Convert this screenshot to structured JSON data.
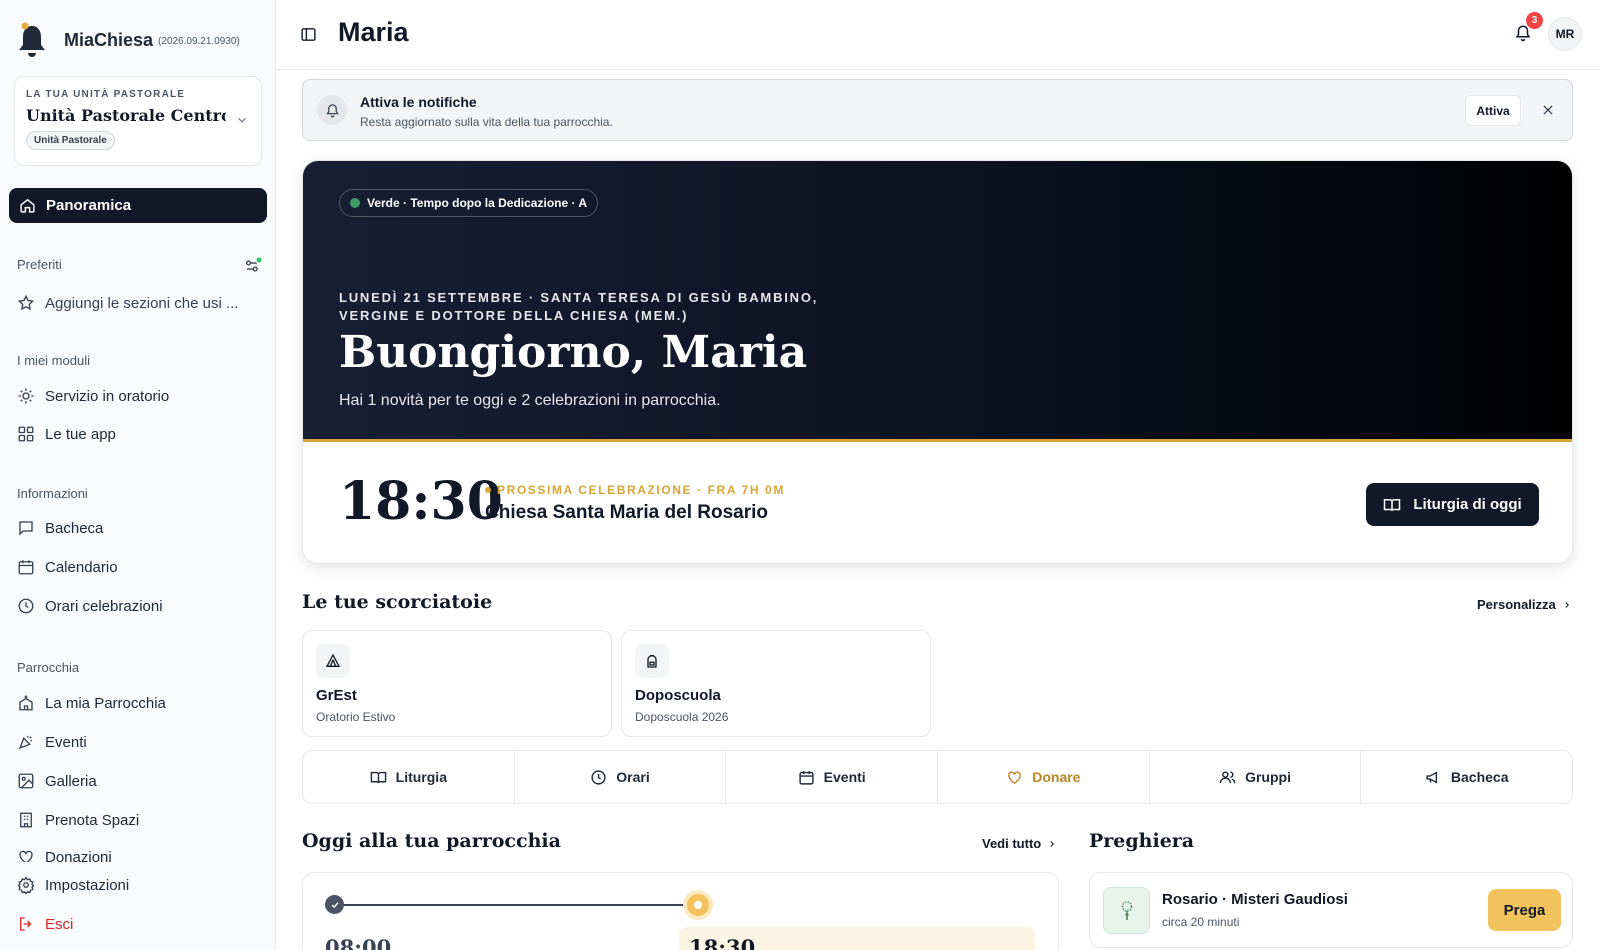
{
  "app": {
    "name": "MiaChiesa",
    "version": "(2026.09.21.0930)",
    "logo_icon": "bell-icon"
  },
  "unit": {
    "label": "LA TUA UNITÀ PASTORALE",
    "name": "Unità Pastorale Centro ...",
    "badge": "Unità Pastorale"
  },
  "nav": {
    "active": {
      "label": "Panoramica",
      "icon": "home-icon"
    },
    "preferiti": {
      "title": "Preferiti",
      "placeholder": "Aggiungi le sezioni che usi ..."
    },
    "moduli": {
      "title": "I miei moduli",
      "items": [
        {
          "label": "Servizio in oratorio",
          "icon": "sun-icon"
        },
        {
          "label": "Le tue app",
          "icon": "grid-icon"
        }
      ]
    },
    "informazioni": {
      "title": "Informazioni",
      "items": [
        {
          "label": "Bacheca",
          "icon": "message-icon"
        },
        {
          "label": "Calendario",
          "icon": "calendar-icon"
        },
        {
          "label": "Orari celebrazioni",
          "icon": "clock-icon"
        }
      ]
    },
    "parrocchia": {
      "title": "Parrocchia",
      "items": [
        {
          "label": "La mia Parrocchia",
          "icon": "church-icon"
        },
        {
          "label": "Eventi",
          "icon": "party-icon"
        },
        {
          "label": "Galleria",
          "icon": "gallery-icon"
        },
        {
          "label": "Prenota Spazi",
          "icon": "building-icon"
        },
        {
          "label": "Donazioni",
          "icon": "heart-icon"
        }
      ]
    },
    "bottom": [
      {
        "label": "Impostazioni",
        "icon": "gear-icon"
      },
      {
        "label": "Esci",
        "icon": "logout-icon"
      }
    ]
  },
  "header": {
    "title": "Maria",
    "notifications_count": "3",
    "avatar": "MR"
  },
  "banner": {
    "title": "Attiva le notifiche",
    "subtitle": "Resta aggiornato sulla vita della tua parrocchia.",
    "button": "Attiva"
  },
  "hero": {
    "pill": "Verde · Tempo dopo la Dedicazione · A",
    "date": "LUNEDÌ 21 SETTEMBRE · SANTA TERESA DI GESÙ BAMBINO, VERGINE E DOTTORE DELLA CHIESA (MEM.)",
    "greeting": "Buongiorno, Maria",
    "subtitle": "Hai 1 novità per te oggi e 2 celebrazioni in parrocchia.",
    "time": "18:30",
    "next_label": "PROSSIMA CELEBRAZIONE · FRA 7H 0M",
    "church": "Chiesa Santa Maria del Rosario",
    "button": "Liturgia di oggi",
    "colors": {
      "liturgical": "#3f9a64",
      "accent": "#d9a536"
    }
  },
  "shortcuts": {
    "title": "Le tue scorciatoie",
    "link": "Personalizza",
    "cards": [
      {
        "name": "GrEst",
        "sub": "Oratorio Estivo",
        "icon": "tent-icon"
      },
      {
        "name": "Doposcuola",
        "sub": "Doposcuola 2026",
        "icon": "backpack-icon"
      }
    ]
  },
  "quick": [
    {
      "label": "Liturgia",
      "icon": "book-icon"
    },
    {
      "label": "Orari",
      "icon": "clock-icon"
    },
    {
      "label": "Eventi",
      "icon": "calendar-icon"
    },
    {
      "label": "Donare",
      "icon": "heart-icon"
    },
    {
      "label": "Gruppi",
      "icon": "users-icon"
    },
    {
      "label": "Bacheca",
      "icon": "megaphone-icon"
    }
  ],
  "today": {
    "title": "Oggi alla tua parrocchia",
    "link": "Vedi tutto",
    "times": [
      "08:00",
      "18:30"
    ]
  },
  "prayer": {
    "title": "Preghiera",
    "item": "Rosario · Misteri Gaudiosi",
    "duration": "circa 20 minuti",
    "button": "Prega"
  }
}
